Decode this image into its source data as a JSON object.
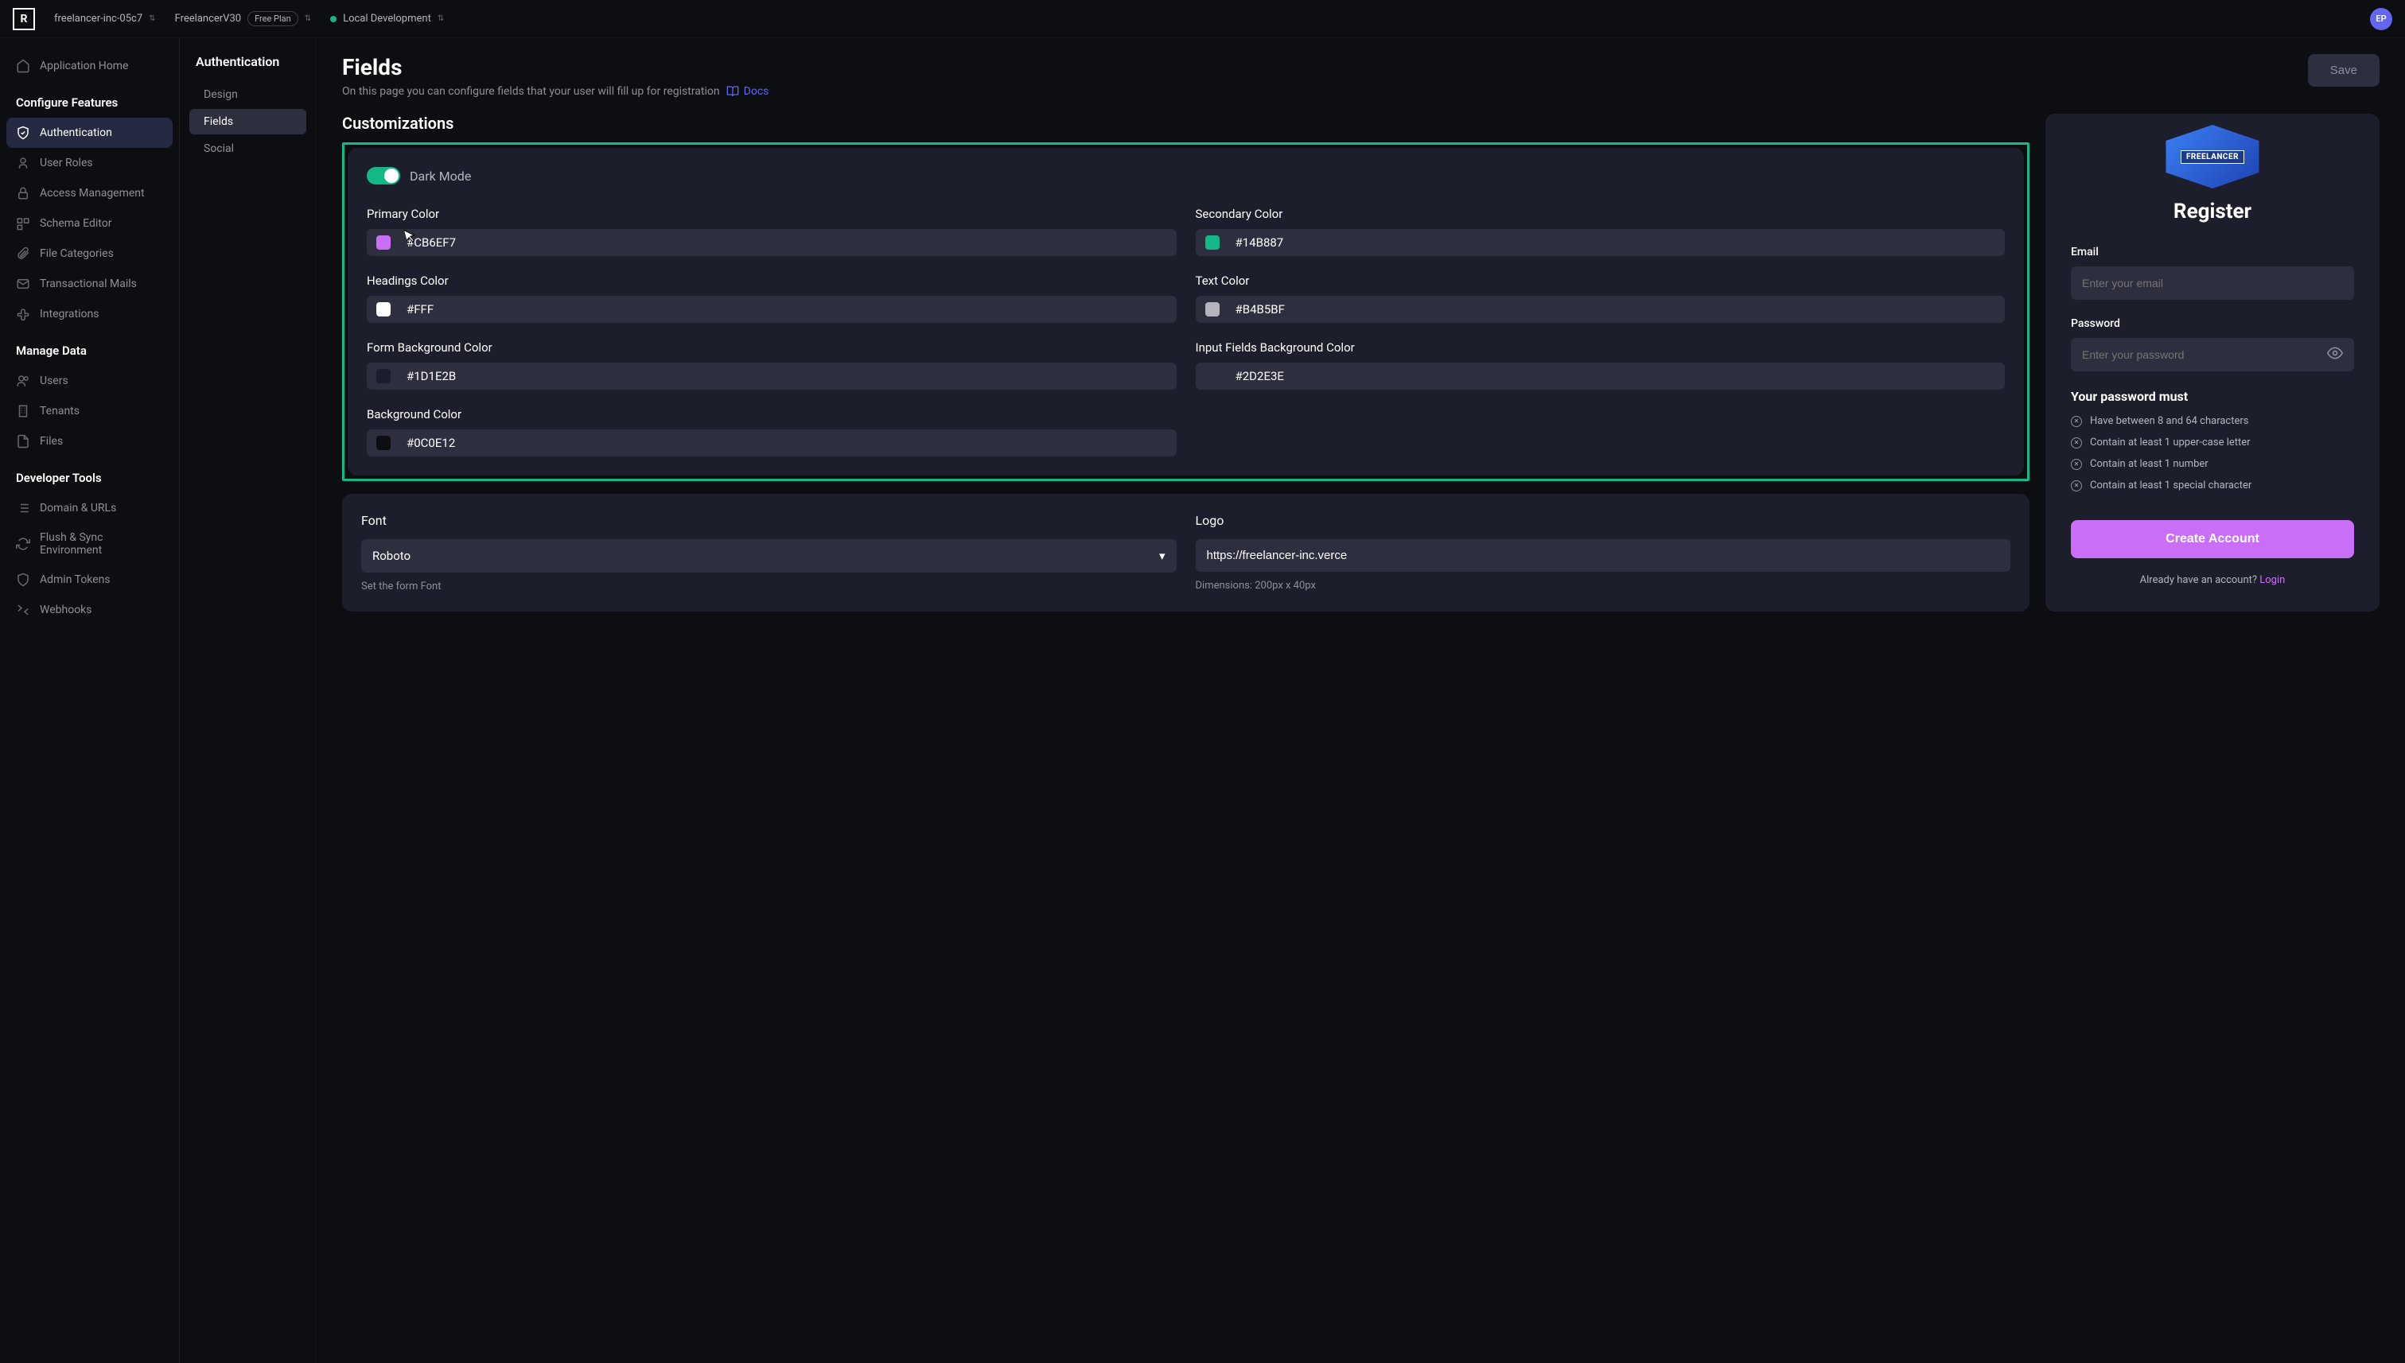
{
  "topbar": {
    "project": "freelancer-inc-05c7",
    "workspace": "FreelancerV30",
    "plan": "Free Plan",
    "env": "Local Development",
    "avatar": "EP"
  },
  "sidebar": {
    "app_home": "Application Home",
    "sections": [
      {
        "title": "Configure Features",
        "items": [
          {
            "icon": "shield-icon",
            "label": "Authentication",
            "active": true
          },
          {
            "icon": "user-icon",
            "label": "User Roles"
          },
          {
            "icon": "lock-icon",
            "label": "Access Management"
          },
          {
            "icon": "schema-icon",
            "label": "Schema Editor"
          },
          {
            "icon": "clip-icon",
            "label": "File Categories"
          },
          {
            "icon": "mail-icon",
            "label": "Transactional Mails"
          },
          {
            "icon": "puzzle-icon",
            "label": "Integrations"
          }
        ]
      },
      {
        "title": "Manage Data",
        "items": [
          {
            "icon": "users-icon",
            "label": "Users"
          },
          {
            "icon": "building-icon",
            "label": "Tenants"
          },
          {
            "icon": "file-icon",
            "label": "Files"
          }
        ]
      },
      {
        "title": "Developer Tools",
        "items": [
          {
            "icon": "list-icon",
            "label": "Domain & URLs"
          },
          {
            "icon": "refresh-icon",
            "label": "Flush & Sync Environment"
          },
          {
            "icon": "shield2-icon",
            "label": "Admin Tokens"
          },
          {
            "icon": "collapse-icon",
            "label": "Webhooks"
          }
        ]
      }
    ]
  },
  "subsidebar": {
    "title": "Authentication",
    "items": [
      {
        "label": "Design"
      },
      {
        "label": "Fields",
        "active": true
      },
      {
        "label": "Social"
      }
    ]
  },
  "page": {
    "title": "Fields",
    "desc": "On this page you can configure fields that your user will fill up for registration",
    "docs": "Docs",
    "save": "Save"
  },
  "customizations": {
    "title": "Customizations",
    "dark_mode": "Dark Mode",
    "colors": [
      {
        "label": "Primary Color",
        "value": "#CB6EF7",
        "swatch": "#CB6EF7"
      },
      {
        "label": "Secondary Color",
        "value": "#14B887",
        "swatch": "#14B887"
      },
      {
        "label": "Headings Color",
        "value": "#FFF",
        "swatch": "#FFFFFF"
      },
      {
        "label": "Text Color",
        "value": "#B4B5BF",
        "swatch": "#B4B5BF"
      },
      {
        "label": "Form Background Color",
        "value": "#1D1E2B",
        "swatch": "#1D1E2B"
      },
      {
        "label": "Input Fields Background Color",
        "value": "#2D2E3E",
        "swatch": "#2D2E3E"
      },
      {
        "label": "Background Color",
        "value": "#0C0E12",
        "swatch": "#0C0E12"
      }
    ]
  },
  "font_logo": {
    "font_label": "Font",
    "font_value": "Roboto",
    "font_help": "Set the form Font",
    "logo_label": "Logo",
    "logo_value": "https://freelancer-inc.verce",
    "logo_help": "Dimensions: 200px x 40px"
  },
  "preview": {
    "logo_text": "FREELANCER",
    "title": "Register",
    "email_label": "Email",
    "email_placeholder": "Enter your email",
    "password_label": "Password",
    "password_placeholder": "Enter your password",
    "pw_title": "Your password must",
    "rules": [
      "Have between 8 and 64 characters",
      "Contain at least 1 upper-case letter",
      "Contain at least 1 number",
      "Contain at least 1 special character"
    ],
    "cta": "Create Account",
    "login_text": "Already have an account? ",
    "login_link": "Login"
  }
}
